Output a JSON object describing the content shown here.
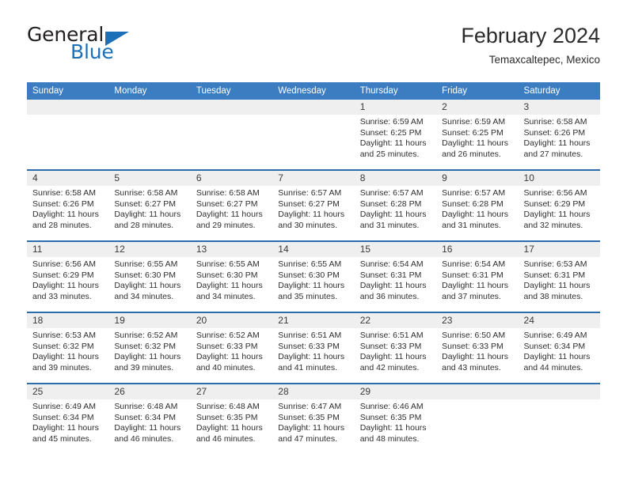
{
  "brand": {
    "word_one": "General",
    "word_two": "Blue",
    "flag_icon": "triangle-flag-icon"
  },
  "header": {
    "title": "February 2024",
    "subtitle": "Temaxcaltepec, Mexico"
  },
  "colors": {
    "header_blue": "#3b7dc0",
    "row_divider_blue": "#2b6cad",
    "brand_blue": "#1b70b8",
    "day_band_gray": "#efefef",
    "text": "#2e2e2e"
  },
  "weekdays": [
    "Sunday",
    "Monday",
    "Tuesday",
    "Wednesday",
    "Thursday",
    "Friday",
    "Saturday"
  ],
  "weeks": [
    [
      {
        "day": "",
        "lines": []
      },
      {
        "day": "",
        "lines": []
      },
      {
        "day": "",
        "lines": []
      },
      {
        "day": "",
        "lines": []
      },
      {
        "day": "1",
        "lines": [
          "Sunrise: 6:59 AM",
          "Sunset: 6:25 PM",
          "Daylight: 11 hours",
          "and 25 minutes."
        ]
      },
      {
        "day": "2",
        "lines": [
          "Sunrise: 6:59 AM",
          "Sunset: 6:25 PM",
          "Daylight: 11 hours",
          "and 26 minutes."
        ]
      },
      {
        "day": "3",
        "lines": [
          "Sunrise: 6:58 AM",
          "Sunset: 6:26 PM",
          "Daylight: 11 hours",
          "and 27 minutes."
        ]
      }
    ],
    [
      {
        "day": "4",
        "lines": [
          "Sunrise: 6:58 AM",
          "Sunset: 6:26 PM",
          "Daylight: 11 hours",
          "and 28 minutes."
        ]
      },
      {
        "day": "5",
        "lines": [
          "Sunrise: 6:58 AM",
          "Sunset: 6:27 PM",
          "Daylight: 11 hours",
          "and 28 minutes."
        ]
      },
      {
        "day": "6",
        "lines": [
          "Sunrise: 6:58 AM",
          "Sunset: 6:27 PM",
          "Daylight: 11 hours",
          "and 29 minutes."
        ]
      },
      {
        "day": "7",
        "lines": [
          "Sunrise: 6:57 AM",
          "Sunset: 6:27 PM",
          "Daylight: 11 hours",
          "and 30 minutes."
        ]
      },
      {
        "day": "8",
        "lines": [
          "Sunrise: 6:57 AM",
          "Sunset: 6:28 PM",
          "Daylight: 11 hours",
          "and 31 minutes."
        ]
      },
      {
        "day": "9",
        "lines": [
          "Sunrise: 6:57 AM",
          "Sunset: 6:28 PM",
          "Daylight: 11 hours",
          "and 31 minutes."
        ]
      },
      {
        "day": "10",
        "lines": [
          "Sunrise: 6:56 AM",
          "Sunset: 6:29 PM",
          "Daylight: 11 hours",
          "and 32 minutes."
        ]
      }
    ],
    [
      {
        "day": "11",
        "lines": [
          "Sunrise: 6:56 AM",
          "Sunset: 6:29 PM",
          "Daylight: 11 hours",
          "and 33 minutes."
        ]
      },
      {
        "day": "12",
        "lines": [
          "Sunrise: 6:55 AM",
          "Sunset: 6:30 PM",
          "Daylight: 11 hours",
          "and 34 minutes."
        ]
      },
      {
        "day": "13",
        "lines": [
          "Sunrise: 6:55 AM",
          "Sunset: 6:30 PM",
          "Daylight: 11 hours",
          "and 34 minutes."
        ]
      },
      {
        "day": "14",
        "lines": [
          "Sunrise: 6:55 AM",
          "Sunset: 6:30 PM",
          "Daylight: 11 hours",
          "and 35 minutes."
        ]
      },
      {
        "day": "15",
        "lines": [
          "Sunrise: 6:54 AM",
          "Sunset: 6:31 PM",
          "Daylight: 11 hours",
          "and 36 minutes."
        ]
      },
      {
        "day": "16",
        "lines": [
          "Sunrise: 6:54 AM",
          "Sunset: 6:31 PM",
          "Daylight: 11 hours",
          "and 37 minutes."
        ]
      },
      {
        "day": "17",
        "lines": [
          "Sunrise: 6:53 AM",
          "Sunset: 6:31 PM",
          "Daylight: 11 hours",
          "and 38 minutes."
        ]
      }
    ],
    [
      {
        "day": "18",
        "lines": [
          "Sunrise: 6:53 AM",
          "Sunset: 6:32 PM",
          "Daylight: 11 hours",
          "and 39 minutes."
        ]
      },
      {
        "day": "19",
        "lines": [
          "Sunrise: 6:52 AM",
          "Sunset: 6:32 PM",
          "Daylight: 11 hours",
          "and 39 minutes."
        ]
      },
      {
        "day": "20",
        "lines": [
          "Sunrise: 6:52 AM",
          "Sunset: 6:33 PM",
          "Daylight: 11 hours",
          "and 40 minutes."
        ]
      },
      {
        "day": "21",
        "lines": [
          "Sunrise: 6:51 AM",
          "Sunset: 6:33 PM",
          "Daylight: 11 hours",
          "and 41 minutes."
        ]
      },
      {
        "day": "22",
        "lines": [
          "Sunrise: 6:51 AM",
          "Sunset: 6:33 PM",
          "Daylight: 11 hours",
          "and 42 minutes."
        ]
      },
      {
        "day": "23",
        "lines": [
          "Sunrise: 6:50 AM",
          "Sunset: 6:33 PM",
          "Daylight: 11 hours",
          "and 43 minutes."
        ]
      },
      {
        "day": "24",
        "lines": [
          "Sunrise: 6:49 AM",
          "Sunset: 6:34 PM",
          "Daylight: 11 hours",
          "and 44 minutes."
        ]
      }
    ],
    [
      {
        "day": "25",
        "lines": [
          "Sunrise: 6:49 AM",
          "Sunset: 6:34 PM",
          "Daylight: 11 hours",
          "and 45 minutes."
        ]
      },
      {
        "day": "26",
        "lines": [
          "Sunrise: 6:48 AM",
          "Sunset: 6:34 PM",
          "Daylight: 11 hours",
          "and 46 minutes."
        ]
      },
      {
        "day": "27",
        "lines": [
          "Sunrise: 6:48 AM",
          "Sunset: 6:35 PM",
          "Daylight: 11 hours",
          "and 46 minutes."
        ]
      },
      {
        "day": "28",
        "lines": [
          "Sunrise: 6:47 AM",
          "Sunset: 6:35 PM",
          "Daylight: 11 hours",
          "and 47 minutes."
        ]
      },
      {
        "day": "29",
        "lines": [
          "Sunrise: 6:46 AM",
          "Sunset: 6:35 PM",
          "Daylight: 11 hours",
          "and 48 minutes."
        ]
      },
      {
        "day": "",
        "lines": []
      },
      {
        "day": "",
        "lines": []
      }
    ]
  ]
}
